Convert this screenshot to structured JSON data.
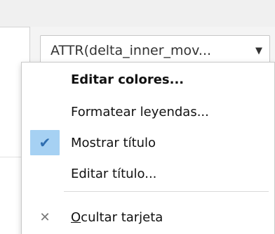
{
  "filter_dropdown": {
    "value": "ATTR(delta_inner_mov...",
    "arrow_icon": "chevron-down-icon"
  },
  "context_menu": {
    "items": [
      {
        "label": "Editar colores...",
        "bold": true,
        "checked": false
      },
      {
        "label": "Formatear leyendas...",
        "bold": false,
        "checked": false
      },
      {
        "label": "Mostrar título",
        "bold": false,
        "checked": true,
        "check_icon": "checkmark-icon"
      },
      {
        "label": "Editar título...",
        "bold": false,
        "checked": false
      }
    ],
    "hide_card": {
      "label_mnemonic": "O",
      "label_rest": "cultar tarjeta",
      "icon": "close-icon"
    }
  },
  "colors": {
    "check_highlight": "#a6d1f3",
    "check_mark": "#2f6eb0"
  }
}
